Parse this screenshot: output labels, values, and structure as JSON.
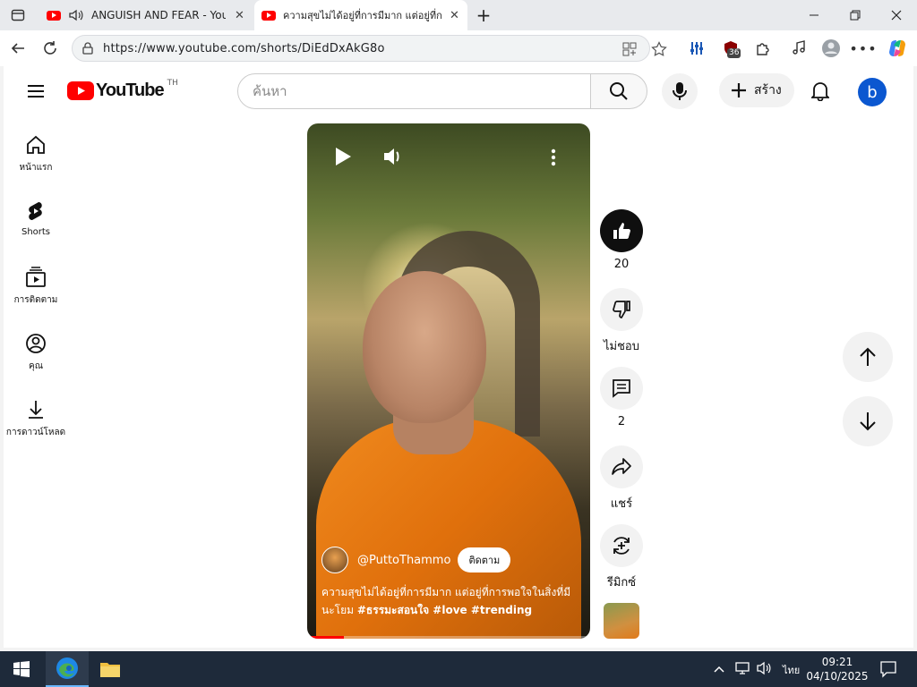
{
  "browser": {
    "tabs": [
      {
        "title": "ANGUISH AND FEAR - YouTube",
        "active": false
      },
      {
        "title": "ความสุขไม่ได้อยู่ที่การมีมาก แต่อยู่ที่การพอใจ",
        "active": true
      }
    ],
    "new_tab_symbol": "+",
    "url": "https://www.youtube.com/shorts/DiEdDxAkG8o",
    "extension_badge": "36"
  },
  "youtube": {
    "logo_text": "YouTube",
    "region": "TH",
    "search_placeholder": "ค้นหา",
    "create_label": "สร้าง",
    "avatar_initial": "b"
  },
  "sidebar": {
    "items": [
      {
        "label": "หน้าแรก",
        "icon": "home-icon"
      },
      {
        "label": "Shorts",
        "icon": "shorts-icon"
      },
      {
        "label": "การติดตาม",
        "icon": "subscriptions-icon"
      },
      {
        "label": "คุณ",
        "icon": "you-icon"
      },
      {
        "label": "การดาวน์โหลด",
        "icon": "download-icon"
      }
    ]
  },
  "short": {
    "channel": "@PuttoThammo",
    "subscribe_label": "ติดตาม",
    "caption_text": "ความสุขไม่ได้อยู่ที่การมีมาก แต่อยู่ที่การพอใจในสิ่งที่มีนะโยม",
    "hashtags": "#ธรรมะสอนใจ #love #trending",
    "progress": 0.13
  },
  "actions": {
    "like_count": "20",
    "dislike_label": "ไม่ชอบ",
    "comment_count": "2",
    "share_label": "แชร์",
    "remix_label": "รีมิกซ์"
  },
  "taskbar": {
    "time": "09:21",
    "date": "04/10/2025",
    "language": "ไทย"
  },
  "colors": {
    "youtube_red": "#ff0000",
    "avatar_blue": "#0b57d0",
    "robe_orange": "#e0700c"
  }
}
